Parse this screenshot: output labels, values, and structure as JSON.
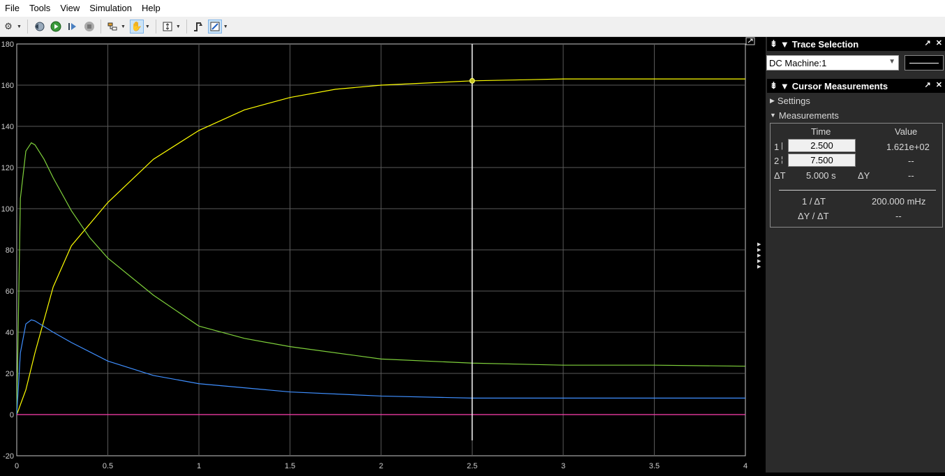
{
  "menu": [
    "File",
    "Tools",
    "View",
    "Simulation",
    "Help"
  ],
  "plot": {
    "xlim": [
      0,
      4
    ],
    "ylim": [
      -20,
      180
    ],
    "xticks": [
      "0",
      "0.5",
      "1",
      "1.5",
      "2",
      "2.5",
      "3",
      "3.5",
      "4"
    ],
    "yticks": [
      "180",
      "160",
      "140",
      "120",
      "100",
      "80",
      "60",
      "40",
      "20",
      "0",
      "-20"
    ],
    "cursor_x": 2.5,
    "cursor_y": 162.1
  },
  "chart_data": {
    "type": "line",
    "xlim": [
      0,
      4
    ],
    "ylim": [
      -20,
      180
    ],
    "grid": true,
    "series": [
      {
        "color": "#ffff00",
        "x": [
          0,
          0.05,
          0.1,
          0.2,
          0.3,
          0.5,
          0.75,
          1,
          1.25,
          1.5,
          1.75,
          2,
          2.5,
          3,
          3.5,
          4
        ],
        "y": [
          0,
          12,
          30,
          62,
          82,
          103,
          124,
          138,
          148,
          154,
          158,
          160,
          162.1,
          163,
          163,
          163
        ]
      },
      {
        "color": "#7fd13b",
        "x": [
          0,
          0.02,
          0.05,
          0.08,
          0.1,
          0.15,
          0.2,
          0.3,
          0.4,
          0.5,
          0.75,
          1,
          1.25,
          1.5,
          2,
          2.5,
          3,
          3.5,
          4
        ],
        "y": [
          0,
          105,
          128,
          132,
          131,
          124,
          115,
          99,
          86,
          76,
          58,
          43,
          37,
          33,
          27,
          25,
          24,
          24,
          23.5
        ]
      },
      {
        "color": "#3f8fff",
        "x": [
          0,
          0.02,
          0.05,
          0.08,
          0.1,
          0.2,
          0.3,
          0.5,
          0.75,
          1,
          1.5,
          2,
          2.5,
          3,
          3.5,
          4
        ],
        "y": [
          0,
          30,
          44,
          46,
          45.5,
          40,
          35,
          26,
          19,
          15,
          11,
          9,
          8,
          8,
          8,
          8
        ]
      },
      {
        "color": "#ff3fb0",
        "x": [
          0,
          4
        ],
        "y": [
          0,
          0
        ]
      }
    ]
  },
  "trace_selection": {
    "title": "Trace Selection",
    "selected": "DC Machine:1"
  },
  "cursor_measurements": {
    "title": "Cursor Measurements",
    "settings_label": "Settings",
    "measurements_label": "Measurements",
    "col_time": "Time",
    "col_value": "Value",
    "row1_label": "1",
    "row1_time": "2.500",
    "row1_value": "1.621e+02",
    "row2_label": "2",
    "row2_time": "7.500",
    "row2_value": "--",
    "dt_label": "ΔT",
    "dt_value": "5.000 s",
    "dy_label": "ΔY",
    "dy_value": "--",
    "inv_dt_label": "1 / ΔT",
    "inv_dt_value": "200.000 mHz",
    "dydt_label": "ΔY / ΔT",
    "dydt_value": "--"
  }
}
